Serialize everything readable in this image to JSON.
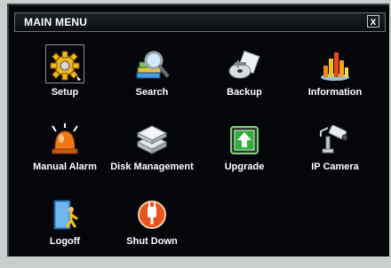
{
  "window": {
    "title": "MAIN MENU",
    "close_glyph": "x"
  },
  "menu": [
    {
      "id": "setup",
      "label": "Setup",
      "icon": "gear-icon"
    },
    {
      "id": "search",
      "label": "Search",
      "icon": "magnifier-search-icon"
    },
    {
      "id": "backup",
      "label": "Backup",
      "icon": "disc-backup-icon"
    },
    {
      "id": "information",
      "label": "Information",
      "icon": "bar-chart-icon"
    },
    {
      "id": "manual-alarm",
      "label": "Manual Alarm",
      "icon": "alarm-light-icon"
    },
    {
      "id": "disk-management",
      "label": "Disk Management",
      "icon": "hard-disk-icon"
    },
    {
      "id": "upgrade",
      "label": "Upgrade",
      "icon": "upgrade-arrow-icon"
    },
    {
      "id": "ip-camera",
      "label": "IP Camera",
      "icon": "camera-icon"
    },
    {
      "id": "logoff",
      "label": "Logoff",
      "icon": "logoff-door-icon"
    },
    {
      "id": "shut-down",
      "label": "Shut Down",
      "icon": "power-icon"
    }
  ],
  "colors": {
    "background": "#04060a",
    "text": "#ffffff",
    "alarm": "#f07814",
    "upgrade": "#2fae3a",
    "power": "#e8541e"
  }
}
